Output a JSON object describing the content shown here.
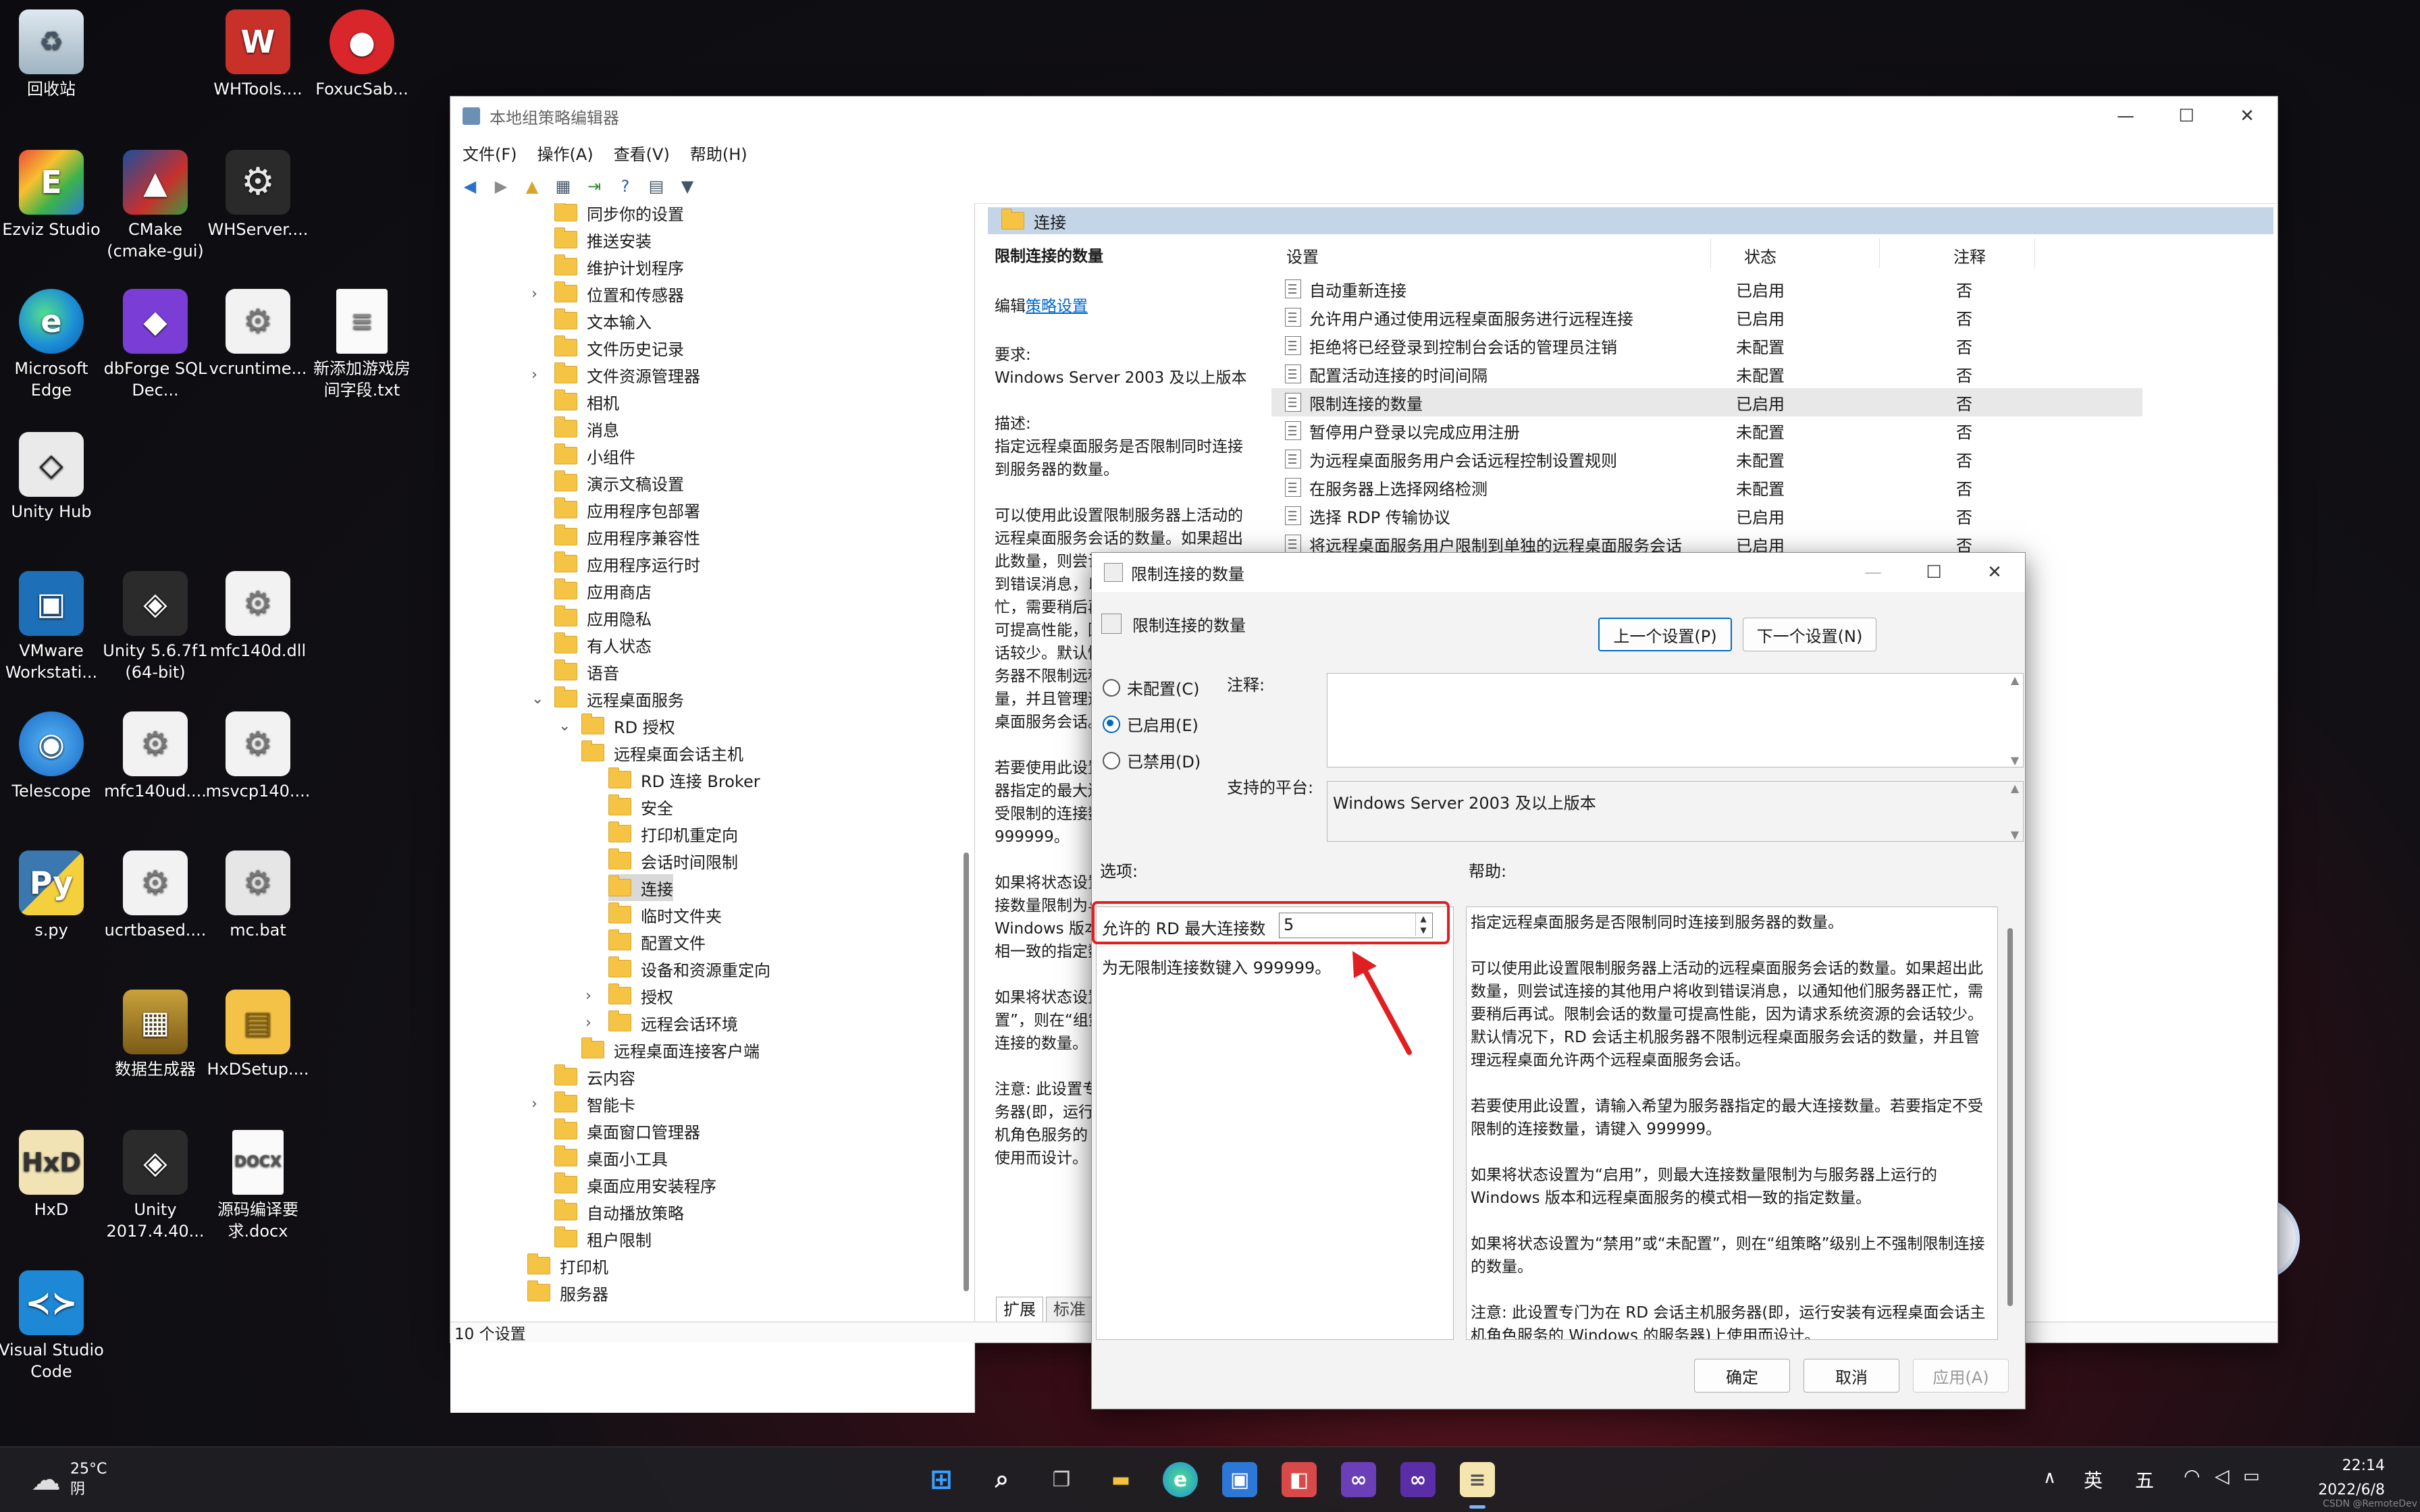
{
  "desktop": {
    "icons": [
      {
        "label": "回收站"
      },
      {
        "label": "WHTools...."
      },
      {
        "label": "FoxucSab..."
      },
      {
        "label": "Ezviz Studio"
      },
      {
        "label": "CMake (cmake-gui)"
      },
      {
        "label": "WHServer...."
      },
      {
        "label": "Microsoft Edge"
      },
      {
        "label": "dbForge SQL Dec..."
      },
      {
        "label": "vcruntime..."
      },
      {
        "label": "新添加游戏房间字段.txt"
      },
      {
        "label": "Unity Hub"
      },
      {
        "label": "VMware Workstati..."
      },
      {
        "label": "Unity 5.6.7f1 (64-bit)"
      },
      {
        "label": "mfc140d.dll"
      },
      {
        "label": "Telescope"
      },
      {
        "label": "mfc140ud...."
      },
      {
        "label": "msvcp140...."
      },
      {
        "label": "s.py"
      },
      {
        "label": "ucrtbased...."
      },
      {
        "label": "mc.bat"
      },
      {
        "label": "数据生成器"
      },
      {
        "label": "HxDSetup...."
      },
      {
        "label": "HxD"
      },
      {
        "label": "Unity 2017.4.40..."
      },
      {
        "label": "源码编译要求.docx"
      },
      {
        "label": "Visual Studio Code"
      }
    ]
  },
  "gpedit": {
    "title": "本地组策略编辑器",
    "menu": [
      "文件(F)",
      "操作(A)",
      "查看(V)",
      "帮助(H)"
    ],
    "tree": [
      "同步你的设置",
      "推送安装",
      "维护计划程序",
      "位置和传感器",
      "文本输入",
      "文件历史记录",
      "文件资源管理器",
      "相机",
      "消息",
      "小组件",
      "演示文稿设置",
      "应用程序包部署",
      "应用程序兼容性",
      "应用程序运行时",
      "应用商店",
      "应用隐私",
      "有人状态",
      "语音",
      "远程桌面服务",
      "RD 授权",
      "远程桌面会话主机",
      "RD 连接 Broker",
      "安全",
      "打印机重定向",
      "会话时间限制",
      "连接",
      "临时文件夹",
      "配置文件",
      "设备和资源重定向",
      "授权",
      "远程会话环境",
      "远程桌面连接客户端",
      "云内容",
      "智能卡",
      "桌面窗口管理器",
      "桌面小工具",
      "桌面应用安装程序",
      "自动播放策略",
      "租户限制",
      "打印机",
      "服务器"
    ],
    "header": "连接",
    "desc": {
      "title": "限制连接的数量",
      "edit_prefix": "编辑",
      "edit_link": "策略设置",
      "req_label": "要求:",
      "req_text": "Windows Server 2003 及以上版本",
      "desc_label": "描述:",
      "p1": "指定远程桌面服务是否限制同时连接到服务器的数量。",
      "p2": "可以使用此设置限制服务器上活动的远程桌面服务会话的数量。如果超出此数量，则尝试连接的其他用户将收到错误消息，以通知他们服务器正忙，需要稍后再试。限制会话的数量可提高性能，因为请求系统资源的会话较少。默认情况下，RD 会话主机服务器不限制远程桌面服务会话的数量，并且管理远程桌面允许两个远程桌面服务会话。",
      "p3": "若要使用此设置，请输入希望为服务器指定的最大连接数量。若要指定不受限制的连接数量，请键入 999999。",
      "p4": "如果将状态设置为“启用”，则最大连接数量限制为与服务器上运行的 Windows 版本和远程桌面服务的模式相一致的指定数量。",
      "p5": "如果将状态设置为“禁用”或“未配置”，则在“组策略”级别上不强制限制连接的数量。",
      "p6": "注意: 此设置专门为在 RD 会话主机服务器(即，运行安装有远程桌面会话主机角色服务的 Windows 的服务器)上使用而设计。"
    },
    "columns": {
      "setting": "设置",
      "state": "状态",
      "comment": "注释"
    },
    "rows": [
      {
        "name": "自动重新连接",
        "state": "已启用",
        "comment": "否"
      },
      {
        "name": "允许用户通过使用远程桌面服务进行远程连接",
        "state": "已启用",
        "comment": "否"
      },
      {
        "name": "拒绝将已经登录到控制台会话的管理员注销",
        "state": "未配置",
        "comment": "否"
      },
      {
        "name": "配置活动连接的时间间隔",
        "state": "未配置",
        "comment": "否"
      },
      {
        "name": "限制连接的数量",
        "state": "已启用",
        "comment": "否"
      },
      {
        "name": "暂停用户登录以完成应用注册",
        "state": "未配置",
        "comment": "否"
      },
      {
        "name": "为远程桌面服务用户会话远程控制设置规则",
        "state": "未配置",
        "comment": "否"
      },
      {
        "name": "在服务器上选择网络检测",
        "state": "未配置",
        "comment": "否"
      },
      {
        "name": "选择 RDP 传输协议",
        "state": "已启用",
        "comment": "否"
      },
      {
        "name": "将远程桌面服务用户限制到单独的远程桌面服务会话",
        "state": "已启用",
        "comment": "否"
      }
    ],
    "tabs": [
      "扩展",
      "标准"
    ],
    "status": "10 个设置"
  },
  "dialog": {
    "title": "限制连接的数量",
    "subtitle": "限制连接的数量",
    "prev": "上一个设置(P)",
    "next": "下一个设置(N)",
    "radio_notconfigured": "未配置(C)",
    "radio_enabled": "已启用(E)",
    "radio_disabled": "已禁用(D)",
    "comment_label": "注释:",
    "platform_label": "支持的平台:",
    "platform_value": "Windows Server 2003 及以上版本",
    "options_label": "选项:",
    "help_label": "帮助:",
    "max_conn_label": "允许的 RD 最大连接数",
    "max_conn_value": "5",
    "max_conn_hint": "为无限制连接数键入 999999。",
    "help": {
      "h1": "指定远程桌面服务是否限制同时连接到服务器的数量。",
      "h2": "可以使用此设置限制服务器上活动的远程桌面服务会话的数量。如果超出此数量，则尝试连接的其他用户将收到错误消息，以通知他们服务器正忙，需要稍后再试。限制会话的数量可提高性能，因为请求系统资源的会话较少。默认情况下，RD 会话主机服务器不限制远程桌面服务会话的数量，并且管理远程桌面允许两个远程桌面服务会话。",
      "h3": "若要使用此设置，请输入希望为服务器指定的最大连接数量。若要指定不受限制的连接数量，请键入 999999。",
      "h4": "如果将状态设置为“启用”，则最大连接数量限制为与服务器上运行的 Windows 版本和远程桌面服务的模式相一致的指定数量。",
      "h5": "如果将状态设置为“禁用”或“未配置”，则在“组策略”级别上不强制限制连接的数量。",
      "h6": "注意: 此设置专门为在 RD 会话主机服务器(即，运行安装有远程桌面会话主机角色服务的 Windows 的服务器)上使用而设计。"
    },
    "ok": "确定",
    "cancel": "取消",
    "apply": "应用(A)"
  },
  "taskbar": {
    "weather_temp": "25°C",
    "weather_desc": "阴",
    "ime1": "英",
    "ime2": "五",
    "time": "22:14",
    "date": "2022/6/8"
  },
  "watermark": "CSDN @RemoteDev",
  "colors": {
    "accent": "#0067c0",
    "highlight_box": "#e02020",
    "arrow": "#e02020"
  }
}
